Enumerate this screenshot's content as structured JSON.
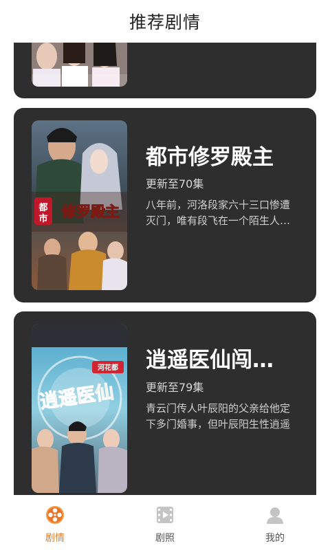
{
  "header": {
    "title": "推荐剧情"
  },
  "cards": [
    {
      "title": "",
      "update": "",
      "description": ""
    },
    {
      "title": "都市修罗殿主",
      "update": "更新至70集",
      "description": "八年前，河洛段家六十三口惨遭灭门，唯有段飞在一个陌生人的帮助下活了下来"
    },
    {
      "title": "逍遥医仙闯…",
      "update": "更新至79集",
      "description": "青云门传人叶辰阳的父亲给他定下多门婚事，但叶辰阳生性逍遥"
    }
  ],
  "poster_texts": {
    "p2": "都市 修罗殿主",
    "p3": "逍遥医仙",
    "p3_badge": "河花都"
  },
  "tabbar": {
    "items": [
      {
        "label": "剧情",
        "icon": "film-reel-icon",
        "active": true
      },
      {
        "label": "剧照",
        "icon": "video-icon",
        "active": false
      },
      {
        "label": "我的",
        "icon": "user-icon",
        "active": false
      }
    ]
  },
  "colors": {
    "accent": "#e07b2a",
    "card_bg": "#2e2e2e",
    "inactive": "#bdbdbd"
  }
}
